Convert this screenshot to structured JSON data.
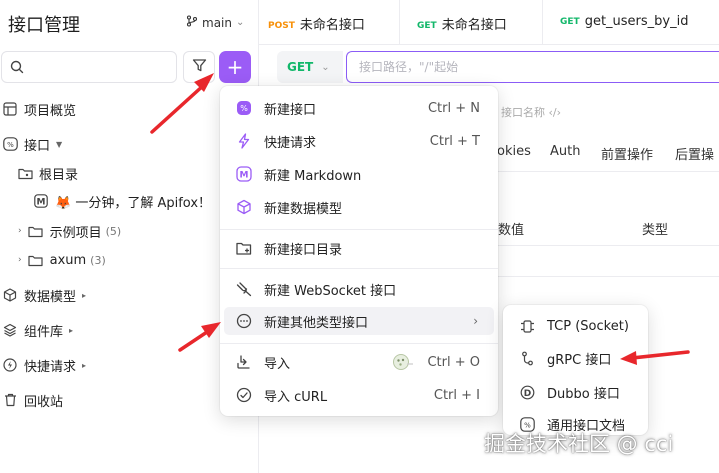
{
  "sidebar": {
    "title": "接口管理",
    "branch": "main",
    "search_placeholder": "",
    "add_label": "+",
    "nav": [
      {
        "label": "项目概览",
        "icon": "project-icon"
      },
      {
        "label": "接口",
        "icon": "api-icon"
      },
      {
        "label": "根目录",
        "icon": "folder-root-icon"
      },
      {
        "label": "🦊 一分钟，了解 Apifox！",
        "icon": "markdown-icon"
      },
      {
        "label": "示例项目",
        "count": "(5)",
        "icon": "folder-icon"
      },
      {
        "label": "axum",
        "count": "(3)",
        "icon": "folder-icon"
      },
      {
        "label": "数据模型",
        "icon": "cube-icon"
      },
      {
        "label": "组件库",
        "icon": "layers-icon"
      },
      {
        "label": "快捷请求",
        "icon": "bolt-icon"
      },
      {
        "label": "回收站",
        "icon": "trash-icon"
      }
    ]
  },
  "tabs": [
    {
      "method": "POST",
      "method_color": "#f79009",
      "label": "未命名接口"
    },
    {
      "method": "GET",
      "method_color": "#12b76a",
      "label": "未命名接口"
    },
    {
      "method": "GET",
      "method_color": "#12b76a",
      "label": "get_users_by_id"
    }
  ],
  "request": {
    "method": "GET",
    "url_placeholder": "接口路径，\"/\"起始",
    "name_placeholder": "接口名称",
    "sub_tabs": [
      "okies",
      "Auth",
      "前置操作",
      "后置操"
    ],
    "col_value": "数值",
    "col_type": "类型"
  },
  "menu": {
    "items": [
      {
        "label": "新建接口",
        "shortcut": "Ctrl + N",
        "icon": "api-new-icon"
      },
      {
        "label": "快捷请求",
        "shortcut": "Ctrl + T",
        "icon": "bolt-icon"
      },
      {
        "label": "新建 Markdown",
        "shortcut": "",
        "icon": "markdown-icon"
      },
      {
        "label": "新建数据模型",
        "shortcut": "",
        "icon": "cube-icon"
      },
      {
        "label": "新建接口目录",
        "shortcut": "",
        "icon": "folder-add-icon"
      },
      {
        "label": "新建 WebSocket 接口",
        "shortcut": "",
        "icon": "websocket-icon"
      },
      {
        "label": "新建其他类型接口",
        "shortcut": "",
        "icon": "more-circle-icon"
      },
      {
        "label": "导入",
        "shortcut": "Ctrl + O",
        "icon": "import-icon"
      },
      {
        "label": "导入 cURL",
        "shortcut": "Ctrl + I",
        "icon": "curl-icon"
      }
    ],
    "submenu_arrow": "›"
  },
  "submenu": {
    "items": [
      {
        "label": "TCP (Socket)",
        "icon": "tcp-icon"
      },
      {
        "label": "gRPC 接口",
        "icon": "grpc-icon"
      },
      {
        "label": "Dubbo 接口",
        "icon": "dubbo-icon"
      },
      {
        "label": "通用接口文档",
        "icon": "doc-icon"
      }
    ]
  },
  "colors": {
    "accent": "#9b5cf6",
    "annotation": "#e8272c",
    "get": "#12b76a",
    "post": "#f79009"
  },
  "watermark": "掘金技术社区 @ cci"
}
